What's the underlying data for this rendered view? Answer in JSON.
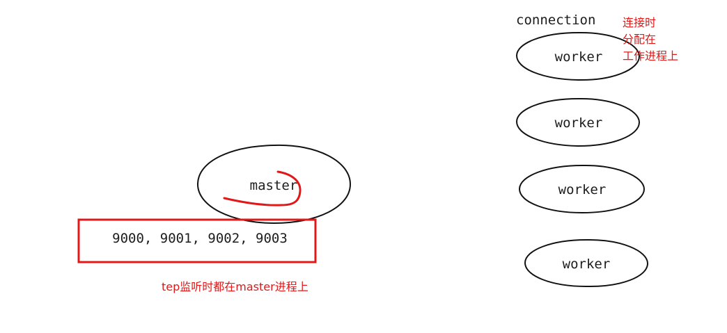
{
  "master": {
    "label": "master",
    "ports_text": "9000, 9001, 9002, 9003",
    "note": "tep监听时都在master进程上"
  },
  "workers": {
    "header": "connection",
    "note_lines": [
      "连接时",
      "分配在",
      "工作进程上"
    ],
    "items": [
      {
        "label": "worker"
      },
      {
        "label": "worker"
      },
      {
        "label": "worker"
      },
      {
        "label": "worker"
      }
    ]
  },
  "colors": {
    "ink": "#111111",
    "annotation_red": "#e01818",
    "background": "#ffffff"
  }
}
